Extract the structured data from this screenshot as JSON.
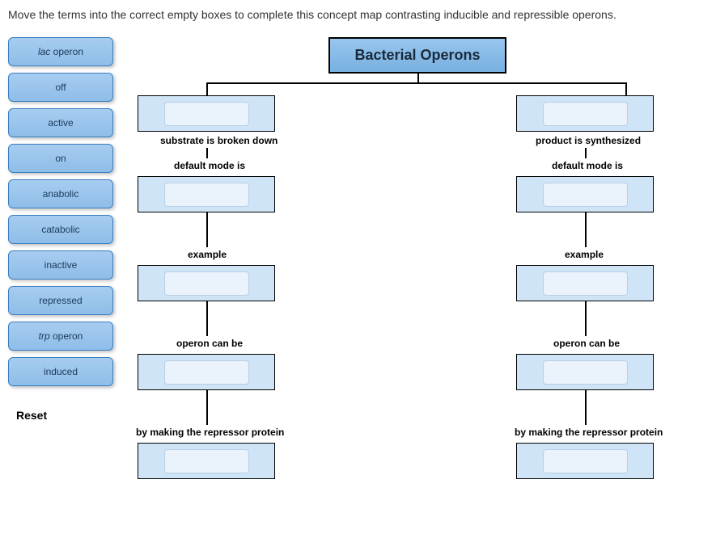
{
  "instructions": "Move the terms into the correct empty boxes to complete this concept map contrasting inducible and repressible operons.",
  "title": "Bacterial Operons",
  "terms": [
    {
      "label": "lac operon",
      "italicPrefix": "lac",
      "rest": " operon"
    },
    {
      "label": "off"
    },
    {
      "label": "active"
    },
    {
      "label": "on"
    },
    {
      "label": "anabolic"
    },
    {
      "label": "catabolic"
    },
    {
      "label": "inactive"
    },
    {
      "label": "repressed"
    },
    {
      "label": "trp operon",
      "italicPrefix": "trp",
      "rest": " operon"
    },
    {
      "label": "induced"
    }
  ],
  "reset": "Reset",
  "left": {
    "lbl1": "substrate is broken down",
    "lbl2": "default mode is",
    "lbl3": "example",
    "lbl4": "operon can be",
    "lbl5": "by making the repressor protein"
  },
  "right": {
    "lbl1": "product is synthesized",
    "lbl2": "default mode is",
    "lbl3": "example",
    "lbl4": "operon can be",
    "lbl5": "by making the repressor protein"
  },
  "chart_data": {
    "type": "diagram",
    "root": "Bacterial Operons",
    "branches": [
      {
        "side": "left",
        "slots": [
          {
            "drop": "empty",
            "connector_below": "substrate is broken down"
          },
          {
            "connector_above": "default mode is",
            "drop": "empty"
          },
          {
            "connector_above": "example",
            "drop": "empty"
          },
          {
            "connector_above": "operon can be",
            "drop": "empty"
          },
          {
            "connector_above": "by making the repressor protein",
            "drop": "empty"
          }
        ]
      },
      {
        "side": "right",
        "slots": [
          {
            "drop": "empty",
            "connector_below": "product is synthesized"
          },
          {
            "connector_above": "default mode is",
            "drop": "empty"
          },
          {
            "connector_above": "example",
            "drop": "empty"
          },
          {
            "connector_above": "operon can be",
            "drop": "empty"
          },
          {
            "connector_above": "by making the repressor protein",
            "drop": "empty"
          }
        ]
      }
    ],
    "draggable_terms": [
      "lac operon",
      "off",
      "active",
      "on",
      "anabolic",
      "catabolic",
      "inactive",
      "repressed",
      "trp operon",
      "induced"
    ]
  }
}
